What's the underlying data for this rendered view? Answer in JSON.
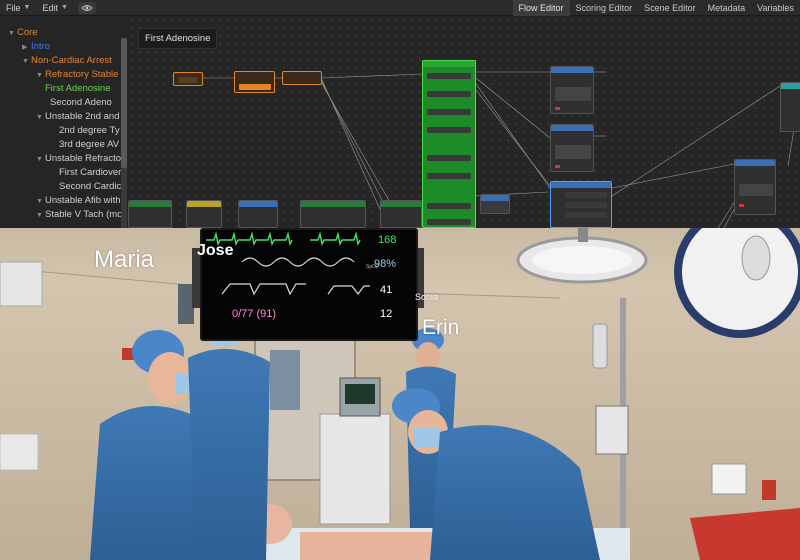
{
  "menubar": {
    "file_label": "File",
    "edit_label": "Edit",
    "tabs": [
      "Flow Editor",
      "Scoring Editor",
      "Scene Editor",
      "Metadata",
      "Variables"
    ],
    "active_tab": "Flow Editor"
  },
  "tree": {
    "items": [
      {
        "label": "Core",
        "color": "#e2852c",
        "expanded": true
      },
      {
        "label": "Intro",
        "color": "#4a78d8",
        "expanded": false
      },
      {
        "label": "Non-Cardiac Arrest",
        "color": "#e2852c",
        "expanded": true
      },
      {
        "label": "Refractory Stable",
        "color": "#e2852c",
        "expanded": true
      },
      {
        "label": "First Adenosine",
        "color": "#6fd14f",
        "expanded": false
      },
      {
        "label": "Second Adeno",
        "color": "#d0d0d0",
        "expanded": false
      },
      {
        "label": "Unstable 2nd and",
        "color": "#d0d0d0",
        "expanded": true
      },
      {
        "label": "2nd degree Ty",
        "color": "#d0d0d0",
        "expanded": false
      },
      {
        "label": "3rd degree AV",
        "color": "#d0d0d0",
        "expanded": false
      },
      {
        "label": "Unstable Refracto",
        "color": "#d0d0d0",
        "expanded": true
      },
      {
        "label": "First Cardiover",
        "color": "#d0d0d0",
        "expanded": false
      },
      {
        "label": "Second Cardic",
        "color": "#d0d0d0",
        "expanded": false
      },
      {
        "label": "Unstable Afib with",
        "color": "#d0d0d0",
        "expanded": true
      },
      {
        "label": "Stable V Tach (mo",
        "color": "#d0d0d0",
        "expanded": true
      }
    ]
  },
  "canvas": {
    "title": "First Adenosine"
  },
  "scene": {
    "names": [
      "Maria",
      "Jose",
      "Sonia",
      "Erin"
    ],
    "monitor": {
      "heart_rate": "168",
      "spo2": "98%",
      "spo2_label": "SpO2",
      "resp": "41",
      "bp": "0/77 (91)",
      "etco2": "12"
    }
  },
  "colors": {
    "orange": "#e2852c",
    "green_node": "#1f8a2a",
    "blue_node": "#3a6fb8",
    "selected_green": "#6fd14f",
    "hr_green": "#47e06a",
    "bp_pink": "#ff8ed8"
  }
}
